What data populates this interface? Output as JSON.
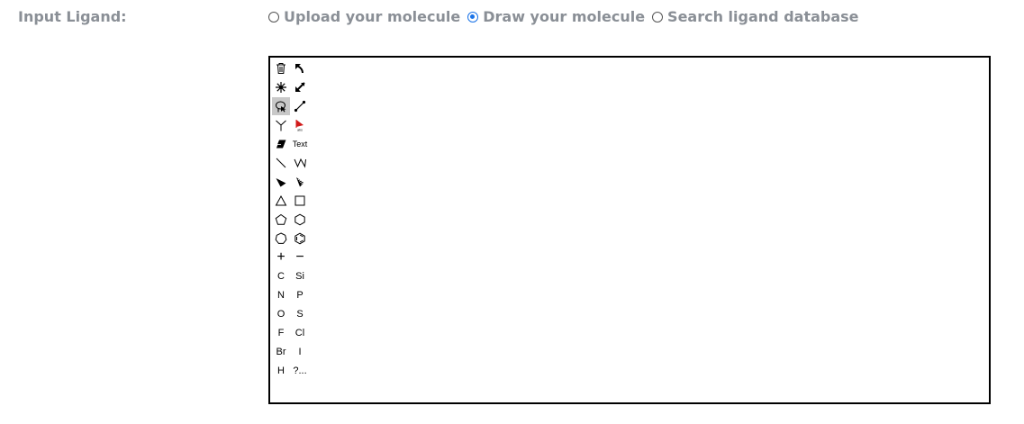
{
  "ligand": {
    "label": "Input Ligand:",
    "options": [
      {
        "label": "Upload your molecule",
        "selected": false
      },
      {
        "label": "Draw your molecule",
        "selected": true
      },
      {
        "label": "Search ligand database",
        "selected": false
      }
    ]
  },
  "editor": {
    "toolbar": {
      "text_tool": "Text",
      "plus": "+",
      "minus": "−",
      "elements": [
        "C",
        "Si",
        "N",
        "P",
        "O",
        "S",
        "F",
        "Cl",
        "Br",
        "I",
        "H",
        "?..."
      ]
    }
  },
  "colors": {
    "accent": "#1a73e8",
    "label": "#8a8f96",
    "active_tool": "#c8c8c8"
  }
}
